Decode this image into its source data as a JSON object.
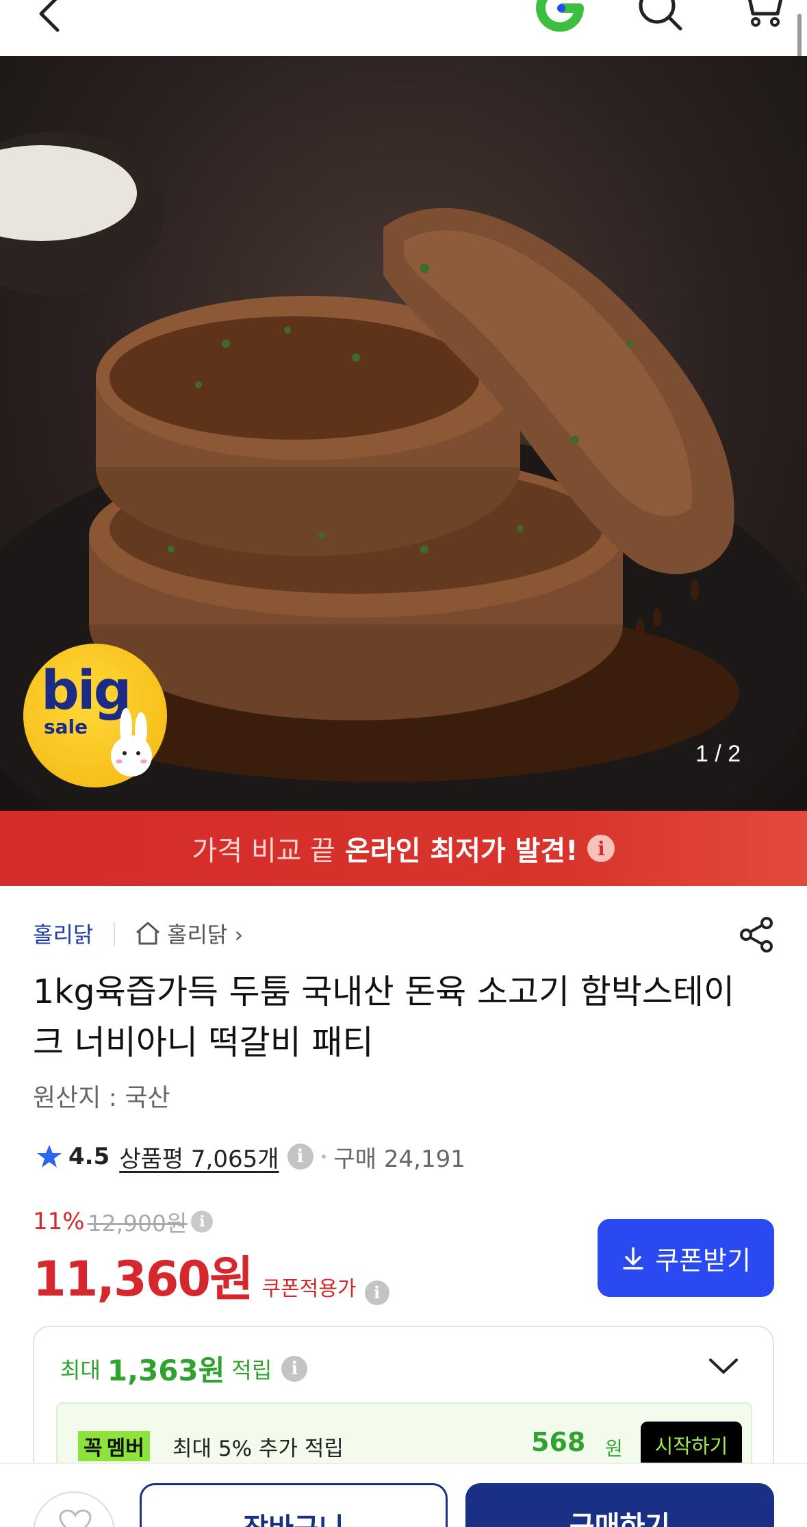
{
  "header": {
    "back_icon": "chevron-left-icon",
    "logo_icon": "g-logo-icon",
    "search_icon": "search-icon",
    "cart_icon": "cart-icon"
  },
  "hero": {
    "counter": "1 / 2",
    "badge_big": "big",
    "badge_sale": "sale"
  },
  "banner": {
    "light_text": "가격 비교 끝",
    "bold_text": "온라인 최저가 발견!",
    "info_glyph": "i",
    "bg_color": "#d42b2b"
  },
  "product": {
    "brand": "홀리닭",
    "store_name": "홀리닭",
    "title": "1kg육즙가득 두툼 국내산 돈육 소고기 함박스테이크 너비아니 떡갈비 패티",
    "origin": "원산지 : 국산",
    "rating": "4.5",
    "review_label": "상품평 7,065개",
    "purchase_label": "구매 24,191"
  },
  "price": {
    "discount": "11%",
    "original": "12,900",
    "original_unit": "원",
    "final": "11,360원",
    "coupon_note": "쿠폰적용가",
    "coupon_button": "쿠폰받기",
    "accent_color": "#d6282c",
    "button_color": "#2a49f0"
  },
  "points": {
    "prefix": "최대",
    "amount": "1,363원",
    "suffix": "적립",
    "member_badge_a": "꼭",
    "member_badge_b": "멤버",
    "member_text": "최대 5% 추가 적립",
    "member_amount": "568",
    "member_unit": "원",
    "start_button": "시작하기",
    "green_color": "#2fa230"
  },
  "bottom": {
    "wish_icon": "heart-icon",
    "cart_button": "장바구니",
    "buy_button": "구매하기",
    "brand_color": "#1a2f86"
  }
}
